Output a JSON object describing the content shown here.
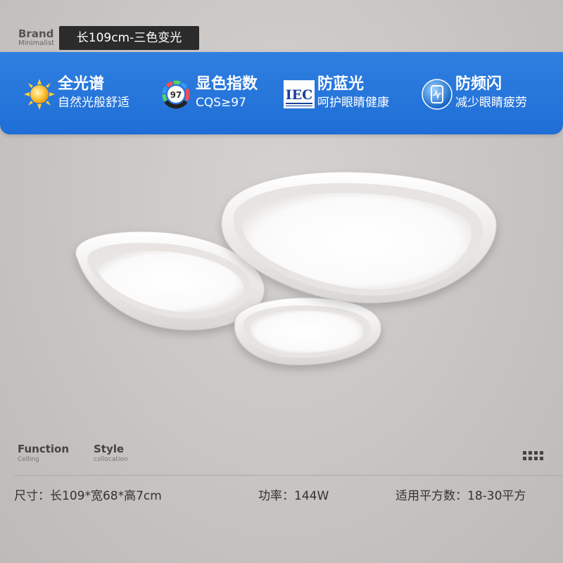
{
  "brand": {
    "title": "Brand",
    "subtitle": "Minimalist"
  },
  "model_tag": "长109cm-三色变光",
  "colors": {
    "banner_blue": "#2a78dc",
    "tag_bg": "#2b2b2b",
    "text_dark": "#333333"
  },
  "features": [
    {
      "icon": "sun-icon",
      "title": "全光谱",
      "subtitle": "自然光般舒适"
    },
    {
      "icon": "cqs-gauge-icon",
      "gauge_value": "97",
      "title": "显色指数",
      "subtitle": "CQS≥97"
    },
    {
      "icon": "iec-logo-icon",
      "logo_text": "IEC",
      "title": "防蓝光",
      "subtitle": "呵护眼睛健康"
    },
    {
      "icon": "flicker-free-icon",
      "title": "防频闪",
      "subtitle": "减少眼睛疲劳"
    }
  ],
  "labels": {
    "function": {
      "title": "Function",
      "subtitle": "Celling"
    },
    "style": {
      "title": "Style",
      "subtitle": "collocation"
    }
  },
  "specs": {
    "size": "尺寸：长109*宽68*高7cm",
    "power": "功率：144W",
    "area": "适用平方数：18-30平方"
  }
}
